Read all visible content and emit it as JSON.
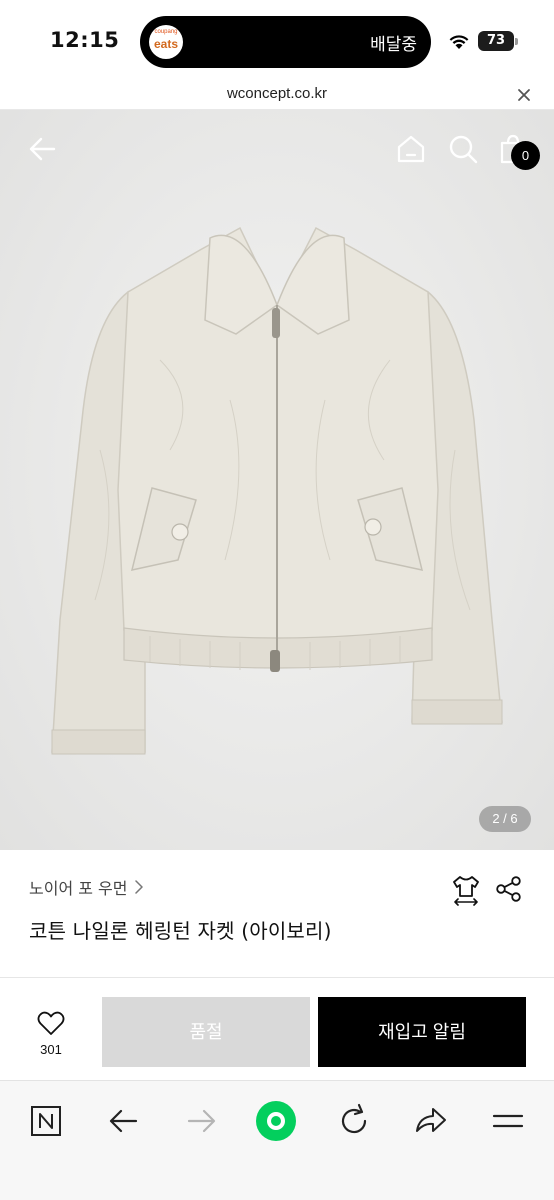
{
  "status_bar": {
    "time": "12:15",
    "island_app_top": "coupang",
    "island_app_bottom": "eats",
    "island_text": "배달중",
    "battery": "73"
  },
  "url_bar": {
    "url": "wconcept.co.kr"
  },
  "product_image": {
    "page_indicator": "2 / 6",
    "cart_count": "0"
  },
  "product": {
    "brand": "노이어 포 우먼",
    "title": "코튼 나일론 헤링턴 자켓 (아이보리)"
  },
  "actions": {
    "wish_count": "301",
    "soldout_label": "품절",
    "restock_label": "재입고 알림"
  },
  "toolbar": {
    "icons": [
      "naver-n-icon",
      "back-arrow-icon",
      "forward-arrow-icon",
      "green-home-icon",
      "refresh-icon",
      "share-arrow-icon",
      "menu-icon"
    ]
  },
  "colors": {
    "accent_green": "#03cf5d",
    "button_black": "#000000",
    "button_disabled": "#d9d9d9"
  }
}
